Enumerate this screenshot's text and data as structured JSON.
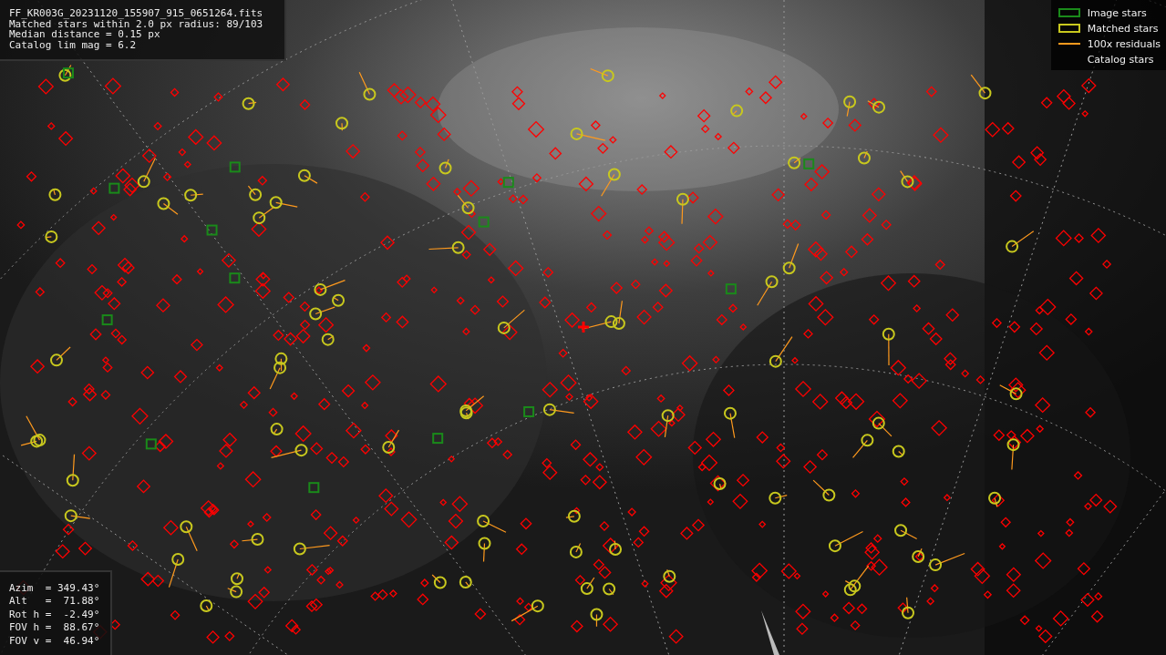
{
  "info_box": {
    "lines": [
      "FF_KR003G_20231120_155907_915_0651264.fits",
      "Matched stars within 2.0 px radius: 89/103",
      "Median distance = 0.15 px",
      "Catalog lim mag = 6.2"
    ]
  },
  "legend": [
    {
      "label": "Image stars",
      "kind": "box",
      "color": "#1a8a1a"
    },
    {
      "label": "Matched stars",
      "kind": "box",
      "color": "#c8c81e"
    },
    {
      "label": "100x residuals",
      "kind": "line",
      "color": "#ff9a1e"
    },
    {
      "label": "Catalog stars",
      "kind": "none",
      "color": "#ff0000"
    }
  ],
  "pointing_box": {
    "lines": [
      "Azim  = 349.43°",
      "Alt   =  71.88°",
      "Rot h =  -2.49°",
      "FOV h =  88.67°",
      "FOV v =  46.94°"
    ]
  }
}
